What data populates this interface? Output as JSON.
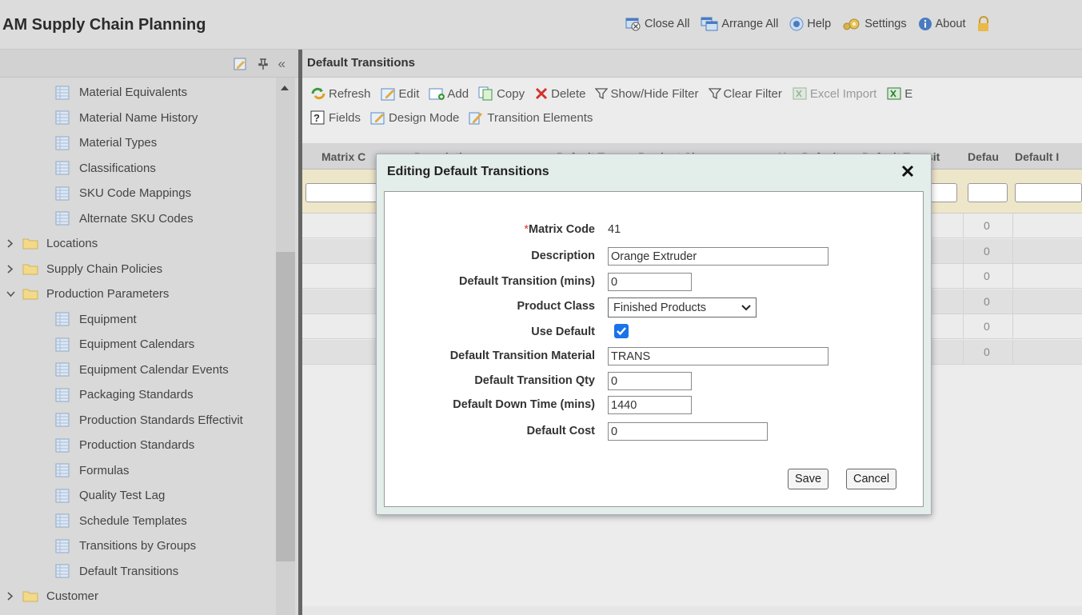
{
  "app": {
    "title": "AM Supply Chain Planning",
    "top_actions": [
      {
        "label": "Close All",
        "icon": "close-all-icon"
      },
      {
        "label": "Arrange All",
        "icon": "arrange-all-icon"
      },
      {
        "label": "Help",
        "icon": "help-icon"
      },
      {
        "label": "Settings",
        "icon": "settings-icon"
      },
      {
        "label": "About",
        "icon": "about-icon"
      }
    ]
  },
  "sidebar": {
    "items": [
      {
        "label": "Material Equivalents",
        "type": "page"
      },
      {
        "label": "Material Name History",
        "type": "page"
      },
      {
        "label": "Material Types",
        "type": "page"
      },
      {
        "label": "Classifications",
        "type": "page"
      },
      {
        "label": "SKU Code Mappings",
        "type": "page"
      },
      {
        "label": "Alternate SKU Codes",
        "type": "page"
      },
      {
        "label": "Locations",
        "type": "folder",
        "expanded": false
      },
      {
        "label": "Supply Chain Policies",
        "type": "folder",
        "expanded": false
      },
      {
        "label": "Production Parameters",
        "type": "folder",
        "expanded": true
      },
      {
        "label": "Equipment",
        "type": "page"
      },
      {
        "label": "Equipment Calendars",
        "type": "page"
      },
      {
        "label": "Equipment Calendar Events",
        "type": "page"
      },
      {
        "label": "Packaging Standards",
        "type": "page"
      },
      {
        "label": "Production Standards Effectivit",
        "type": "page"
      },
      {
        "label": "Production Standards",
        "type": "page"
      },
      {
        "label": "Formulas",
        "type": "page"
      },
      {
        "label": "Quality Test Lag",
        "type": "page"
      },
      {
        "label": "Schedule Templates",
        "type": "page"
      },
      {
        "label": "Transitions by Groups",
        "type": "page"
      },
      {
        "label": "Default Transitions",
        "type": "page"
      },
      {
        "label": "Customer",
        "type": "folder",
        "expanded": false
      }
    ]
  },
  "panel": {
    "title": "Default Transitions",
    "toolbar_row1": [
      {
        "label": "Refresh",
        "icon": "refresh-icon",
        "enabled": true
      },
      {
        "label": "Edit",
        "icon": "edit-icon",
        "enabled": true
      },
      {
        "label": "Add",
        "icon": "add-icon",
        "enabled": true
      },
      {
        "label": "Copy",
        "icon": "copy-icon",
        "enabled": true
      },
      {
        "label": "Delete",
        "icon": "delete-icon",
        "enabled": true
      },
      {
        "label": "Show/Hide Filter",
        "icon": "filter-icon",
        "enabled": true
      },
      {
        "label": "Clear Filter",
        "icon": "clear-filter-icon",
        "enabled": true
      },
      {
        "label": "Excel Import",
        "icon": "excel-import-icon",
        "enabled": false
      },
      {
        "label": "E",
        "icon": "excel-export-icon",
        "enabled": true
      }
    ],
    "toolbar_row2": [
      {
        "label": "Fields",
        "icon": "fields-icon"
      },
      {
        "label": "Design Mode",
        "icon": "design-mode-icon"
      },
      {
        "label": "Transition Elements",
        "icon": "transition-elements-icon"
      }
    ],
    "columns": [
      "Matrix C",
      "Description",
      "Default T",
      "Product Class",
      "Use Default",
      "Default Transit",
      "Defau",
      "Default I"
    ],
    "rows": [
      "0",
      "0",
      "0",
      "0",
      "0",
      "0"
    ]
  },
  "dialog": {
    "title": "Editing Default Transitions",
    "required_mark": "*",
    "fields": {
      "matrix_code": {
        "label": "Matrix Code",
        "value": "41"
      },
      "description": {
        "label": "Description",
        "value": "Orange Extruder"
      },
      "default_transition": {
        "label": "Default Transition (mins)",
        "value": "0"
      },
      "product_class": {
        "label": "Product Class",
        "value": "Finished Products"
      },
      "use_default": {
        "label": "Use Default",
        "checked": true
      },
      "transition_material": {
        "label": "Default Transition Material",
        "value": "TRANS"
      },
      "transition_qty": {
        "label": "Default Transition Qty",
        "value": "0"
      },
      "down_time": {
        "label": "Default Down Time (mins)",
        "value": "1440"
      },
      "cost": {
        "label": "Default Cost",
        "value": "0"
      }
    },
    "save_label": "Save",
    "cancel_label": "Cancel"
  }
}
